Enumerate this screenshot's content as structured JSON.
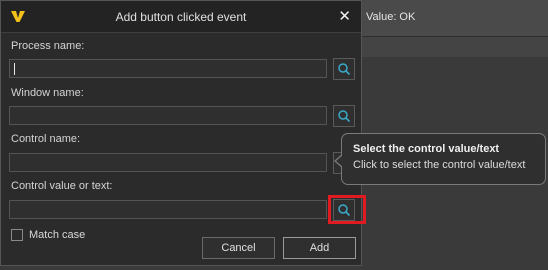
{
  "background": {
    "value_text": "Value: OK"
  },
  "dialog": {
    "title": "Add button clicked event",
    "close_glyph": "✕",
    "fields": [
      {
        "label": "Process name:",
        "value": ""
      },
      {
        "label": "Window name:",
        "value": ""
      },
      {
        "label": "Control name:",
        "value": ""
      },
      {
        "label": "Control value or text:",
        "value": ""
      }
    ],
    "match_case_label": "Match case",
    "match_case_checked": false,
    "cancel_label": "Cancel",
    "add_label": "Add"
  },
  "tooltip": {
    "title": "Select the control value/text",
    "body": "Click to select the control value/text"
  },
  "colors": {
    "accent_icon": "#3aa9c9",
    "highlight": "#e11b22",
    "logo": "#f2c21a"
  }
}
